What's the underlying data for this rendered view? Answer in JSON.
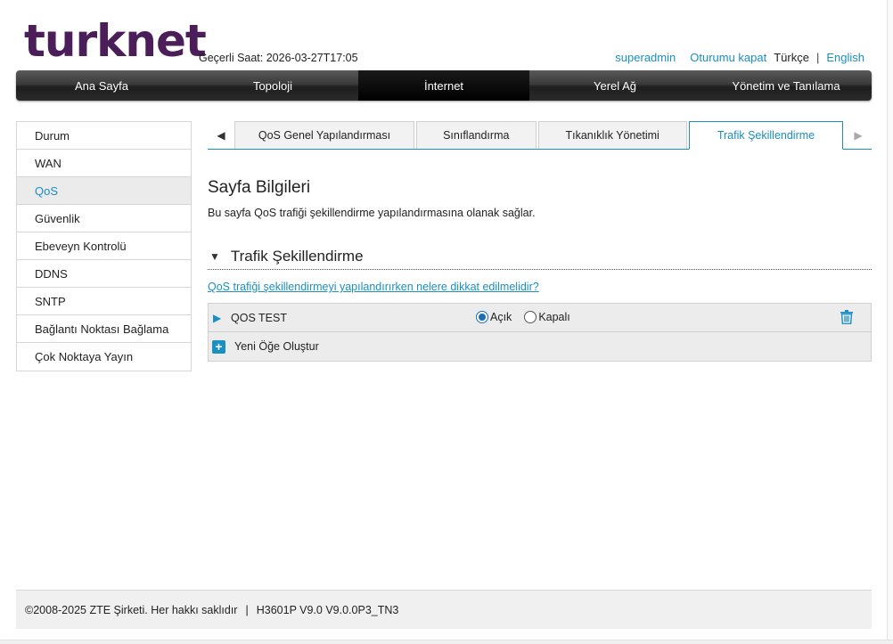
{
  "header": {
    "logo_text": "turknet",
    "clock": "Geçerli Saat: 2026-03-27T17:05",
    "user": "superadmin",
    "logout": "Oturumu kapat",
    "lang_current": "Türkçe",
    "lang_sep": "|",
    "lang_other": "English"
  },
  "nav": {
    "items": [
      "Ana Sayfa",
      "Topoloji",
      "İnternet",
      "Yerel Ağ",
      "Yönetim ve Tanılama"
    ],
    "active": "İnternet"
  },
  "sidebar": {
    "items": [
      "Durum",
      "WAN",
      "QoS",
      "Güvenlik",
      "Ebeveyn Kontrolü",
      "DDNS",
      "SNTP",
      "Bağlantı Noktası Bağlama",
      "Çok Noktaya Yayın"
    ],
    "active": "QoS"
  },
  "subtabs": {
    "items": [
      "QoS Genel Yapılandırması",
      "Sınıflandırma",
      "Tıkanıklık Yönetimi",
      "Trafik Şekillendirme"
    ],
    "active": "Trafik Şekillendirme"
  },
  "content": {
    "title": "Sayfa Bilgileri",
    "description": "Bu sayfa QoS trafiği şekillendirme yapılandırmasına olanak sağlar.",
    "section_title": "Trafik Şekillendirme",
    "help_link": "QoS trafiği şekillendirmeyi yapılandırırken nelere dikkat edilmelidir?",
    "rule": {
      "name": "QOS TEST",
      "option_on": "Açık",
      "option_off": "Kapalı",
      "selected": "Açık"
    },
    "new_item": "Yeni Öğe Oluştur"
  },
  "footer": {
    "copyright": "©2008-2025 ZTE Şirketi. Her hakkı saklıdır",
    "sep": "|",
    "version": "H3601P V9.0 V9.0.0P3_TN3"
  },
  "colors": {
    "accent": "#1a8fc1",
    "logo": "#4b1e5a",
    "navbar": "#2b2b2b"
  },
  "icons": {
    "tab_prev": "triangle-left-icon",
    "tab_next": "triangle-right-icon",
    "section": "triangle-down-icon",
    "expand": "triangle-right-icon",
    "delete": "trash-icon",
    "add": "plus-icon"
  }
}
